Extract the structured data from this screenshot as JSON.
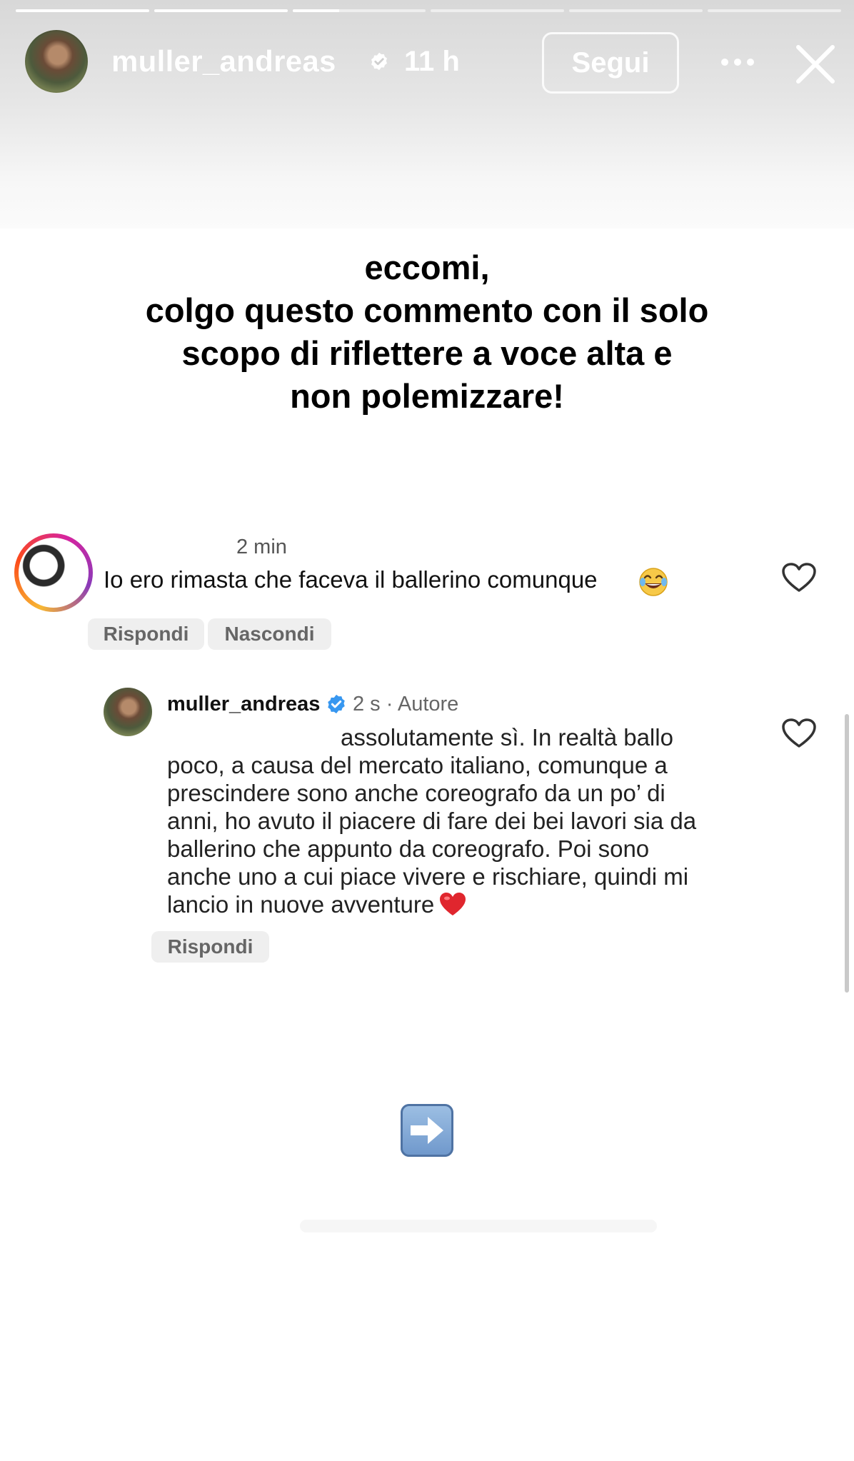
{
  "story": {
    "progress": [
      1.0,
      1.0,
      0.35,
      0,
      0,
      0
    ],
    "username": "muller_andreas",
    "time": "11 h",
    "follow_label": "Segui",
    "icons": [
      "verified-icon",
      "more-icon",
      "close-icon"
    ]
  },
  "headline": {
    "lines": [
      "eccomi,",
      "colgo questo commento con il solo",
      "scopo di riflettere a voce alta e",
      "non polemizzare!"
    ]
  },
  "comment": {
    "time": "2 min",
    "text": "Io ero rimasta che faceva il ballerino comunque",
    "emoji": "face-with-tears-of-joy",
    "reply_label": "Rispondi",
    "hide_label": "Nascondi"
  },
  "reply": {
    "username": "muller_andreas",
    "meta": "2 s · Autore",
    "lines": [
      "assolutamente sì. In realtà ballo",
      "poco, a causa del mercato italiano, comunque a",
      "prescindere sono anche coreografo da un po’ di",
      "anni, ho avuto il piacere di fare dei bei lavori sia da",
      "ballerino che appunto da coreografo. Poi sono",
      "anche uno a cui piace vivere e rischiare, quindi mi",
      "lancio in nuove avventure"
    ],
    "emoji": "red-heart",
    "reply_label": "Rispondi"
  },
  "sticker": {
    "icon": "right-arrow-icon"
  },
  "colors": {
    "verified_blue": "#3797f0",
    "story_ring": "#d6249f",
    "heart_red": "#e0262e"
  }
}
